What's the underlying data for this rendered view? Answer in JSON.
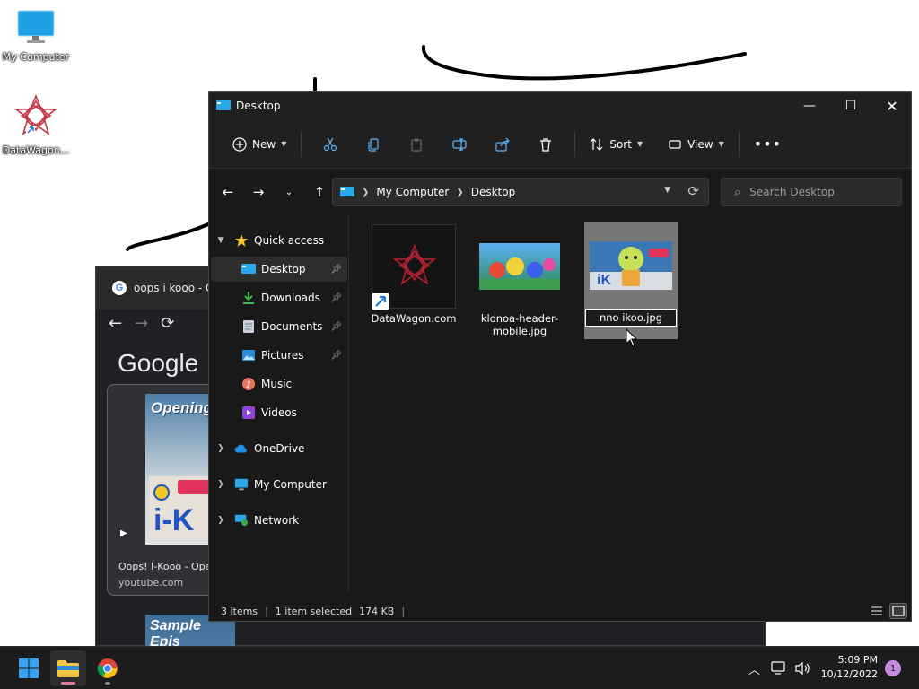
{
  "desktop": {
    "icons": [
      {
        "label": "My Computer"
      },
      {
        "label": "DataWagon..."
      }
    ]
  },
  "chrome": {
    "tab_title": "oops i kooo - G",
    "logo": "Google",
    "video": {
      "thumb_text": "Opening",
      "title": "Oops! I-Kooo - Ope",
      "source": "youtube.com"
    },
    "next_thumb_text": "Sample Epis"
  },
  "explorer": {
    "title": "Desktop",
    "toolbar": {
      "new_label": "New",
      "sort_label": "Sort",
      "view_label": "View"
    },
    "address": {
      "crumbs": [
        "My Computer",
        "Desktop"
      ]
    },
    "search": {
      "placeholder": "Search Desktop"
    },
    "nav": {
      "quick_access": "Quick access",
      "items": [
        {
          "label": "Desktop"
        },
        {
          "label": "Downloads"
        },
        {
          "label": "Documents"
        },
        {
          "label": "Pictures"
        },
        {
          "label": "Music"
        },
        {
          "label": "Videos"
        }
      ],
      "onedrive": "OneDrive",
      "my_computer": "My Computer",
      "network": "Network"
    },
    "files": [
      {
        "name": "DataWagon.com"
      },
      {
        "name": "klonoa-header-mobile.jpg"
      },
      {
        "name": "nno ikoo.jpg"
      }
    ],
    "status": {
      "items": "3 items",
      "selected": "1 item selected",
      "size": "174 KB"
    }
  },
  "taskbar": {
    "time": "5:09 PM",
    "date": "10/12/2022",
    "notifications": "1"
  },
  "colors": {
    "explorer_bg": "#191919",
    "accent_folder": "#f4c542",
    "selection": "#777777"
  }
}
